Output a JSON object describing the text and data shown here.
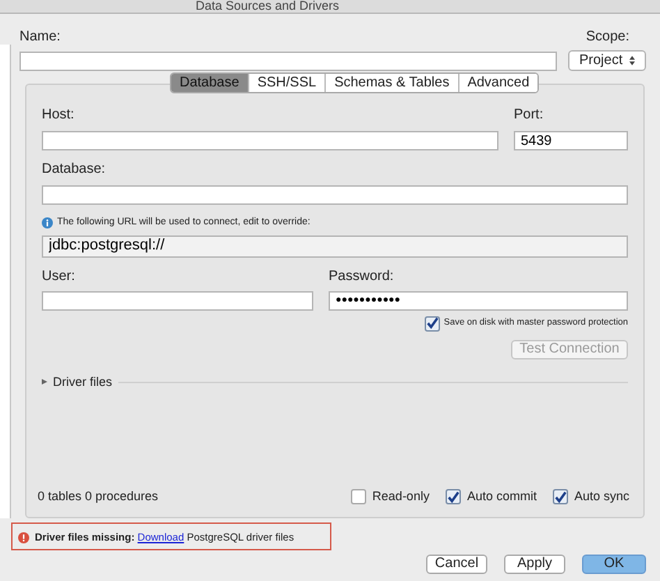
{
  "window": {
    "title": "Data Sources and Drivers"
  },
  "name": {
    "label": "Name:"
  },
  "scope": {
    "label": "Scope:",
    "value": "Project"
  },
  "tabs": [
    {
      "label": "Database",
      "selected": true
    },
    {
      "label": "SSH/SSL",
      "selected": false
    },
    {
      "label": "Schemas & Tables",
      "selected": false
    },
    {
      "label": "Advanced",
      "selected": false
    }
  ],
  "host": {
    "label": "Host:"
  },
  "port": {
    "label": "Port:",
    "value": "5439"
  },
  "database": {
    "label": "Database:"
  },
  "url_hint": "The following URL will be used to connect, edit to override:",
  "url": {
    "value": "jdbc:postgresql://"
  },
  "user": {
    "label": "User:"
  },
  "password": {
    "label": "Password:",
    "value": "●●●●●●●●●●●"
  },
  "save_on_disk": {
    "label": "Save on disk with master password protection",
    "checked": true
  },
  "test_button": {
    "label": "Test Connection",
    "disabled": true
  },
  "driver_files": {
    "label": "Driver files",
    "expanded": false
  },
  "status": "0 tables 0 procedures",
  "options": [
    {
      "label": "Read-only",
      "checked": false
    },
    {
      "label": "Auto commit",
      "checked": true
    },
    {
      "label": "Auto sync",
      "checked": true
    }
  ],
  "error": {
    "prefix": "Driver files missing:",
    "link": "Download",
    "suffix": "PostgreSQL driver files"
  },
  "buttons": [
    {
      "label": "Cancel",
      "primary": false
    },
    {
      "label": "Apply",
      "primary": false
    },
    {
      "label": "OK",
      "primary": true
    }
  ]
}
